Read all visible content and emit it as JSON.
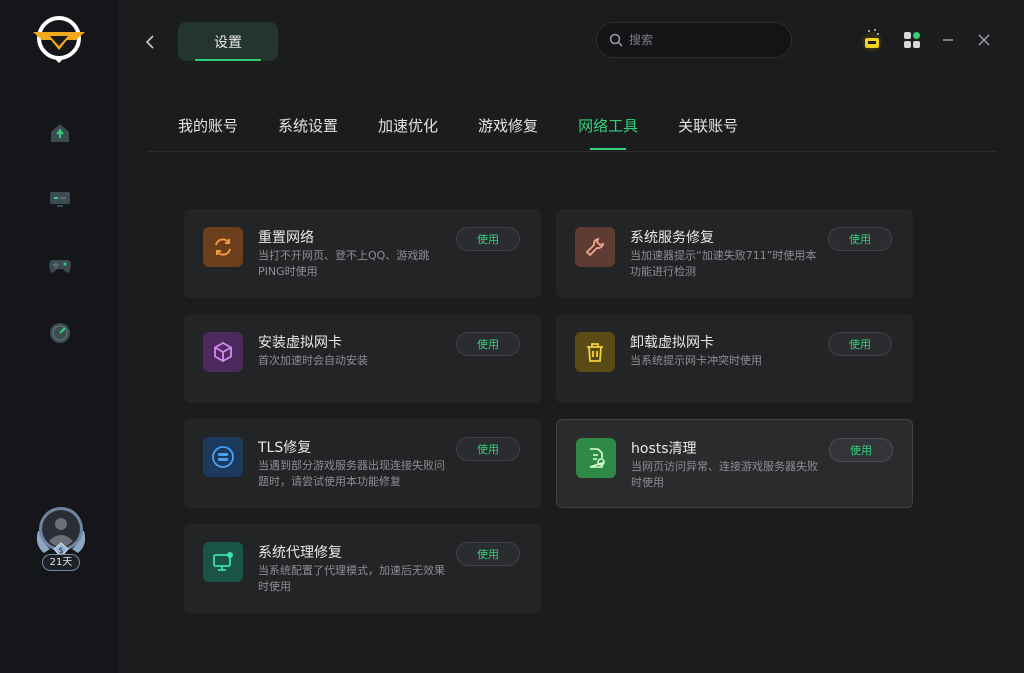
{
  "header": {
    "title": "设置",
    "search_placeholder": "搜索"
  },
  "tabs": [
    {
      "label": "我的账号",
      "active": false
    },
    {
      "label": "系统设置",
      "active": false
    },
    {
      "label": "加速优化",
      "active": false
    },
    {
      "label": "游戏修复",
      "active": false
    },
    {
      "label": "网络工具",
      "active": true
    },
    {
      "label": "关联账号",
      "active": false
    }
  ],
  "user": {
    "days": "21天"
  },
  "tools": [
    {
      "title": "重置网络",
      "desc": "当打不开网页、登不上QQ、游戏跳PING时使用",
      "button": "使用",
      "icon": "refresh-icon",
      "color": "#e98a3a"
    },
    {
      "title": "系统服务修复",
      "desc": "当加速器提示“加速失败711”时使用本功能进行检测",
      "button": "使用",
      "icon": "wrench-icon",
      "color": "#e0907a"
    },
    {
      "title": "安装虚拟网卡",
      "desc": "首次加速时会自动安装",
      "button": "使用",
      "icon": "box-icon",
      "color": "#c47ae8"
    },
    {
      "title": "卸载虚拟网卡",
      "desc": "当系统提示网卡冲突时使用",
      "button": "使用",
      "icon": "trash-icon",
      "color": "#e8c53a"
    },
    {
      "title": "TLS修复",
      "desc": "当遇到部分游戏服务器出现连接失败问题时，请尝试使用本功能修复",
      "button": "使用",
      "icon": "network-icon",
      "color": "#3a8ee8"
    },
    {
      "title": "hosts清理",
      "desc": "当网页访问异常、连接游戏服务器失败时使用",
      "button": "使用",
      "icon": "document-clean-icon",
      "color": "#3dcf6a"
    },
    {
      "title": "系统代理修复",
      "desc": "当系统配置了代理模式，加速后无效果时使用",
      "button": "使用",
      "icon": "monitor-icon",
      "color": "#36d0a0"
    }
  ],
  "colors": {
    "accent": "#36d07c",
    "brand": "#f2b21c"
  }
}
